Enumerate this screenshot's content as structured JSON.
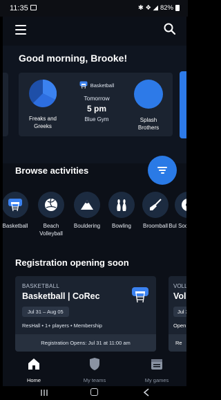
{
  "status_bar": {
    "time": "11:35",
    "indicators": "✱ ❖ ◢",
    "battery": "82%"
  },
  "top_bar": {
    "menu_icon": "hamburger-menu-icon",
    "search_icon": "search-icon"
  },
  "greeting": {
    "text": "Good morning, Brooke!",
    "card": {
      "left_team": {
        "name": "Freaks and Greeks",
        "icon": "pie-chart-icon",
        "color": "#2d6ee0"
      },
      "sport": "Basketball",
      "day": "Tomorrow",
      "time": "5 pm",
      "venue": "Blue Gym",
      "right_team": {
        "name": "Splash Brothers",
        "icon": "circle-avatar-icon",
        "color": "#2d7ae8"
      }
    }
  },
  "browse": {
    "title": "Browse activities",
    "filter_icon": "filter-icon",
    "activities": [
      {
        "label": "Basketball",
        "icon": "basketball-hoop-icon"
      },
      {
        "label": "Beach Volleyball",
        "icon": "volleyball-icon"
      },
      {
        "label": "Bouldering",
        "icon": "mountain-icon"
      },
      {
        "label": "Bowling",
        "icon": "bowling-pins-icon"
      },
      {
        "label": "Broomball",
        "icon": "broom-icon"
      },
      {
        "label": "Bul Soc",
        "icon": "ball-icon"
      }
    ]
  },
  "registration": {
    "title": "Registration opening soon",
    "cards": [
      {
        "sport": "BASKETBALL",
        "name": "Basketball | CoRec",
        "dates": "Jul 31 – Aug 05",
        "meta": "ResHall • 1+ players • Membership",
        "opens": "Registration Opens: Jul 31 at 11:00 am"
      },
      {
        "sport": "VOLL",
        "name": "Voll",
        "dates": "Jul 3",
        "meta": "Open",
        "opens": "Re"
      }
    ]
  },
  "bottom_nav": [
    {
      "label": "Home",
      "icon": "home-icon",
      "active": true
    },
    {
      "label": "My teams",
      "icon": "shield-icon",
      "active": false
    },
    {
      "label": "My games",
      "icon": "calendar-icon",
      "active": false
    }
  ],
  "colors": {
    "accent": "#2a7ae6",
    "background": "#0c1018",
    "card": "#1b2330"
  }
}
